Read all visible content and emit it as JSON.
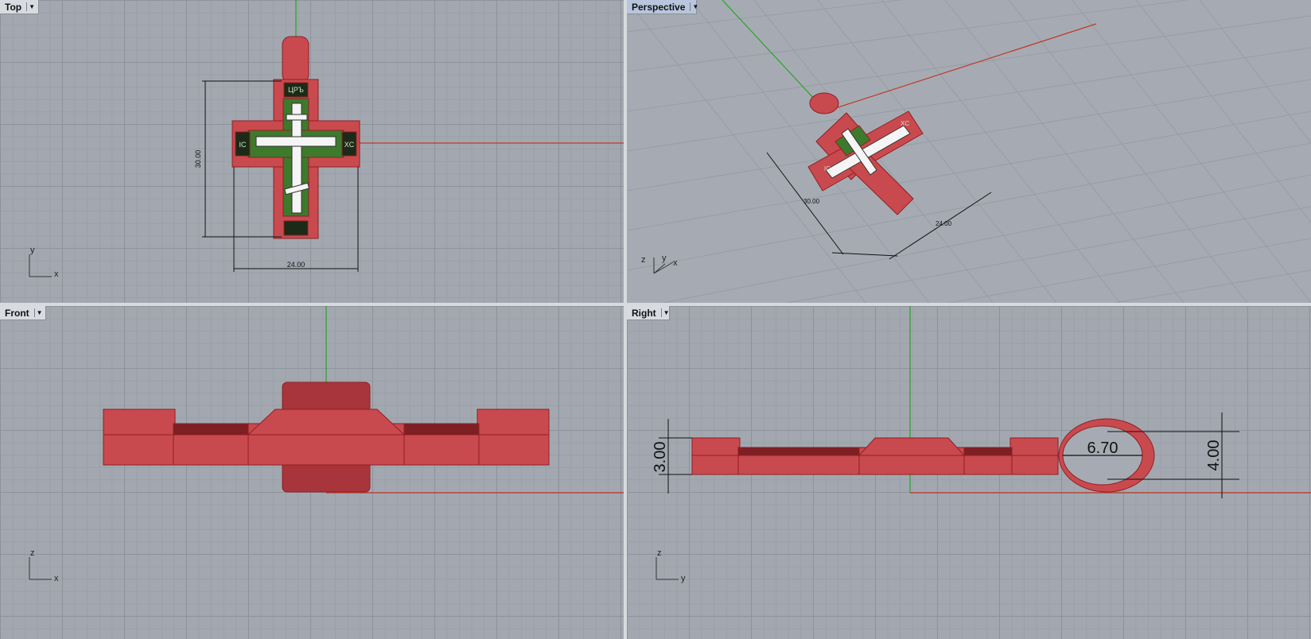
{
  "viewports": {
    "top": {
      "title": "Top",
      "dim_height": "30.00",
      "dim_width": "24.00",
      "axis_a": "y",
      "axis_b": "x",
      "glyph_left": "IC",
      "glyph_right": "XC",
      "glyph_top": "ЦРЪ"
    },
    "perspective": {
      "title": "Perspective",
      "dim_height": "30.00",
      "dim_width": "24.00",
      "axis_a": "z",
      "axis_b": "y",
      "axis_c": "x",
      "glyph_left": "IC",
      "glyph_right": "XC"
    },
    "front": {
      "title": "Front",
      "axis_a": "z",
      "axis_b": "x"
    },
    "right": {
      "title": "Right",
      "dim_thickness": "3.00",
      "dim_inner": "6.70",
      "dim_ring": "4.00",
      "axis_a": "z",
      "axis_b": "y"
    }
  },
  "icons": {
    "dropdown": "dropdown-arrow-icon"
  },
  "colors": {
    "object_red": "#c94a4e",
    "object_edge": "#8e1f24",
    "cross_white": "#f5f5f5",
    "inlay_green": "#3e7a2c",
    "axis_x": "#c0392b",
    "axis_y": "#27a327"
  }
}
